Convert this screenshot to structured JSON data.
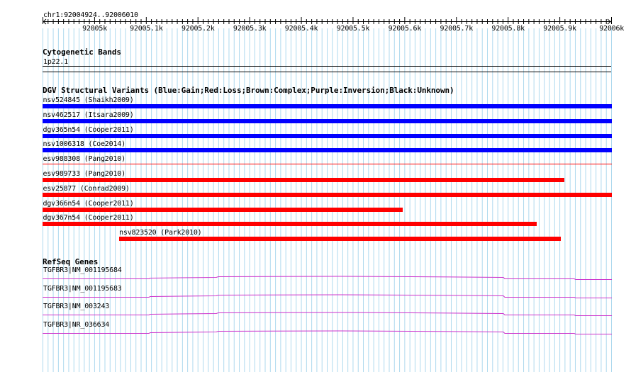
{
  "ruler": {
    "region_label": "chr1:92004924..92006010",
    "ticks": [
      "92005k",
      "92005.1k",
      "92005.2k",
      "92005.3k",
      "92005.4k",
      "92005.5k",
      "92005.6k",
      "92005.7k",
      "92005.8k",
      "92005.9k",
      "92006k"
    ]
  },
  "cytoband": {
    "title": "Cytogenetic Bands",
    "band": "1p22.1"
  },
  "dgv": {
    "title": "DGV Structural Variants (Blue:Gain;Red:Loss;Brown:Complex;Purple:Inversion;Black:Unknown)",
    "colors": {
      "gain": "#0000ff",
      "loss": "#ff0000"
    },
    "variants": [
      {
        "label": "nsv524845 (Shaikh2009)",
        "type": "gain",
        "start_frac": 0.0,
        "end_frac": 1.0,
        "thin": false
      },
      {
        "label": "nsv462517 (Itsara2009)",
        "type": "gain",
        "start_frac": 0.0,
        "end_frac": 1.0,
        "thin": false
      },
      {
        "label": "dgv365n54 (Cooper2011)",
        "type": "gain",
        "start_frac": 0.0,
        "end_frac": 1.0,
        "thin": false
      },
      {
        "label": "nsv1006318 (Coe2014)",
        "type": "gain",
        "start_frac": 0.0,
        "end_frac": 1.0,
        "thin": false
      },
      {
        "label": "esv988308 (Pang2010)",
        "type": "loss",
        "start_frac": 0.0,
        "end_frac": 1.0,
        "thin": true
      },
      {
        "label": "esv989733 (Pang2010)",
        "type": "loss",
        "start_frac": 0.0,
        "end_frac": 0.917,
        "thin": false
      },
      {
        "label": "esv25877 (Conrad2009)",
        "type": "loss",
        "start_frac": 0.0,
        "end_frac": 1.0,
        "thin": false
      },
      {
        "label": "dgv366n54 (Cooper2011)",
        "type": "loss",
        "start_frac": 0.0,
        "end_frac": 0.632,
        "thin": false
      },
      {
        "label": "dgv367n54 (Cooper2011)",
        "type": "loss",
        "start_frac": 0.0,
        "end_frac": 0.868,
        "thin": false
      },
      {
        "label": "nsv823520 (Park2010)",
        "type": "loss",
        "start_frac": 0.134,
        "end_frac": 0.91,
        "thin": false
      }
    ]
  },
  "refseq": {
    "title": "RefSeq Genes",
    "color": "#cc33cc",
    "genes": [
      {
        "label": "TGFBR3|NM_001195684"
      },
      {
        "label": "TGFBR3|NM_001195683"
      },
      {
        "label": "TGFBR3|NM_003243"
      },
      {
        "label": "TGFBR3|NR_036634"
      }
    ]
  }
}
